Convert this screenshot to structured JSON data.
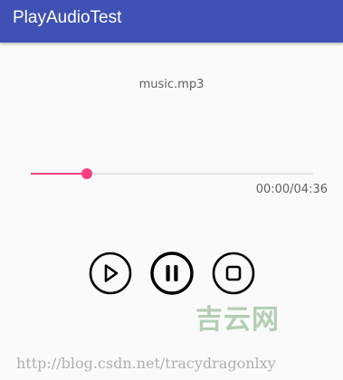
{
  "app_bar": {
    "title": "PlayAudioTest",
    "color": "#3f51b5"
  },
  "player": {
    "file_name": "music.mp3",
    "seek": {
      "progress_fraction": 0.2,
      "accent_color": "#ff4081"
    },
    "time_display": "00:00/04:36",
    "controls": [
      {
        "name": "play",
        "icon": "play-icon"
      },
      {
        "name": "pause",
        "icon": "pause-icon"
      },
      {
        "name": "stop",
        "icon": "stop-icon"
      }
    ]
  },
  "watermark": {
    "brand": "吉云网",
    "url": "http://blog.csdn.net/tracydragonlxy"
  }
}
